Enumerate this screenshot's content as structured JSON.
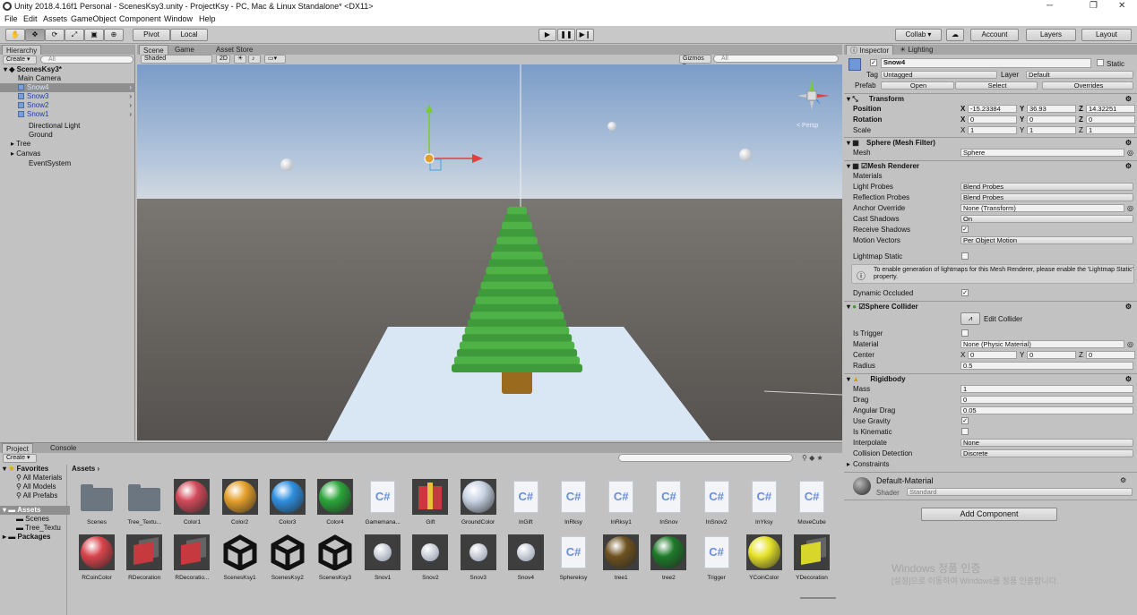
{
  "window": {
    "title": "Unity 2018.4.16f1 Personal - ScenesKsy3.unity - ProjectKsy - PC, Mac & Linux Standalone* <DX11>",
    "minimize": "─",
    "maximize": "❐",
    "close": "✕"
  },
  "menu": [
    "File",
    "Edit",
    "Assets",
    "GameObject",
    "Component",
    "Window",
    "Help"
  ],
  "toolbar": {
    "pivot": "Pivot",
    "local": "Local",
    "collab": "Collab ▾",
    "account": "Account",
    "layers": "Layers",
    "layout": "Layout"
  },
  "hierarchy": {
    "tab": "Hierarchy",
    "create": "Create ▾",
    "search_placeholder": "All",
    "scene": "ScenesKsy3*",
    "items": [
      "Main Camera",
      "Snow4",
      "Snow3",
      "Snow2",
      "Snow1",
      "Directional Light",
      "Ground",
      "Tree",
      "Canvas",
      "EventSystem"
    ]
  },
  "scene_view": {
    "tabs": [
      "Scene",
      "Game",
      "Asset Store"
    ],
    "shading": "Shaded",
    "mode2d": "2D",
    "gizmos": "Gizmos ▾",
    "search_placeholder": "All",
    "persp": "< Persp"
  },
  "project": {
    "tabs": [
      "Project",
      "Console"
    ],
    "create": "Create ▾",
    "breadcrumb": "Assets",
    "favorites": "Favorites",
    "fav_items": [
      "All Materials",
      "All Models",
      "All Prefabs"
    ],
    "assets_folder": "Assets",
    "asset_children": [
      "Scenes",
      "Tree_Textu"
    ],
    "packages": "Packages",
    "assets_row1": [
      {
        "name": "Scenes",
        "kind": "folder"
      },
      {
        "name": "Tree_Textu...",
        "kind": "folder"
      },
      {
        "name": "Color1",
        "kind": "sphere",
        "color": "#d34a5a"
      },
      {
        "name": "Color2",
        "kind": "sphere",
        "color": "#e5a02a"
      },
      {
        "name": "Color3",
        "kind": "sphere",
        "color": "#2e8fe0"
      },
      {
        "name": "Color4",
        "kind": "sphere",
        "color": "#2aa53a"
      },
      {
        "name": "Gamemana...",
        "kind": "cs"
      },
      {
        "name": "Gift",
        "kind": "gift"
      },
      {
        "name": "GroundColor",
        "kind": "sphere",
        "color": "#c8d3e4"
      },
      {
        "name": "InGift",
        "kind": "cs"
      },
      {
        "name": "InRksy",
        "kind": "cs"
      },
      {
        "name": "InRksy1",
        "kind": "cs"
      },
      {
        "name": "InSnov",
        "kind": "cs"
      },
      {
        "name": "InSnov2",
        "kind": "cs"
      },
      {
        "name": "InYksy",
        "kind": "cs"
      },
      {
        "name": "MoveCube",
        "kind": "cs"
      }
    ],
    "assets_row2": [
      {
        "name": "RCoinColor",
        "kind": "sphere",
        "color": "#d8444c"
      },
      {
        "name": "RDecoration",
        "kind": "cube",
        "color": "#c5393f"
      },
      {
        "name": "RDecoratio...",
        "kind": "cube",
        "color": "#c5393f"
      },
      {
        "name": "ScenesKsy1",
        "kind": "unity"
      },
      {
        "name": "ScenesKsy2",
        "kind": "unity"
      },
      {
        "name": "ScenesKsy3",
        "kind": "unity"
      },
      {
        "name": "Snov1",
        "kind": "smallsphere"
      },
      {
        "name": "Snov2",
        "kind": "smallsphere"
      },
      {
        "name": "Snov3",
        "kind": "smallsphere"
      },
      {
        "name": "Snov4",
        "kind": "smallsphere"
      },
      {
        "name": "Sphereksy",
        "kind": "cs"
      },
      {
        "name": "tree1",
        "kind": "sphere",
        "color": "#6e5220"
      },
      {
        "name": "tree2",
        "kind": "sphere",
        "color": "#1e7a2a"
      },
      {
        "name": "Trigger",
        "kind": "cs"
      },
      {
        "name": "YCoinColor",
        "kind": "sphere",
        "color": "#e6e22a"
      },
      {
        "name": "YDecoration",
        "kind": "cube",
        "color": "#d8d62a"
      }
    ]
  },
  "inspector": {
    "tabs": [
      "Inspector",
      "Lighting"
    ],
    "object_name": "Snow4",
    "static": "Static",
    "tag_label": "Tag",
    "tag": "Untagged",
    "layer_label": "Layer",
    "layer": "Default",
    "prefab_label": "Prefab",
    "prefab_open": "Open",
    "prefab_select": "Select",
    "prefab_overrides": "Overrides",
    "transform": {
      "title": "Transform",
      "position": "Position",
      "rotation": "Rotation",
      "scale": "Scale",
      "pos": [
        "-15.23384",
        "36.93",
        "14.32251"
      ],
      "rot": [
        "0",
        "0",
        "0"
      ],
      "scl": [
        "1",
        "1",
        "1"
      ]
    },
    "mesh_filter": {
      "title": "Sphere (Mesh Filter)",
      "mesh_label": "Mesh",
      "mesh": "Sphere"
    },
    "mesh_renderer": {
      "title": "Mesh Renderer",
      "materials": "Materials",
      "light_probes": "Light Probes",
      "light_probes_val": "Blend Probes",
      "reflection_probes": "Reflection Probes",
      "reflection_val": "Blend Probes",
      "anchor": "Anchor Override",
      "anchor_val": "None (Transform)",
      "cast": "Cast Shadows",
      "cast_val": "On",
      "receive": "Receive Shadows",
      "motion": "Motion Vectors",
      "motion_val": "Per Object Motion",
      "lightmap_static": "Lightmap Static",
      "info": "To enable generation of lightmaps for this Mesh Renderer, please enable the 'Lightmap Static' property.",
      "dynamic_occluded": "Dynamic Occluded"
    },
    "sphere_collider": {
      "title": "Sphere Collider",
      "edit": "Edit Collider",
      "is_trigger": "Is Trigger",
      "material": "Material",
      "material_val": "None (Physic Material)",
      "center": "Center",
      "center_val": [
        "0",
        "0",
        "0"
      ],
      "radius": "Radius",
      "radius_val": "0.5"
    },
    "rigidbody": {
      "title": "Rigidbody",
      "mass": "Mass",
      "mass_val": "1",
      "drag": "Drag",
      "drag_val": "0",
      "angular": "Angular Drag",
      "angular_val": "0.05",
      "gravity": "Use Gravity",
      "kinematic": "Is Kinematic",
      "interpolate": "Interpolate",
      "interpolate_val": "None",
      "collision": "Collision Detection",
      "collision_val": "Discrete",
      "constraints": "Constraints"
    },
    "material": {
      "name": "Default-Material",
      "shader_label": "Shader",
      "shader": "Standard"
    },
    "add_component": "Add Component",
    "watermark1": "Windows 정품 인증",
    "watermark2": "[설정]으로 이동하여 Windows를 정품 인증합니다."
  }
}
